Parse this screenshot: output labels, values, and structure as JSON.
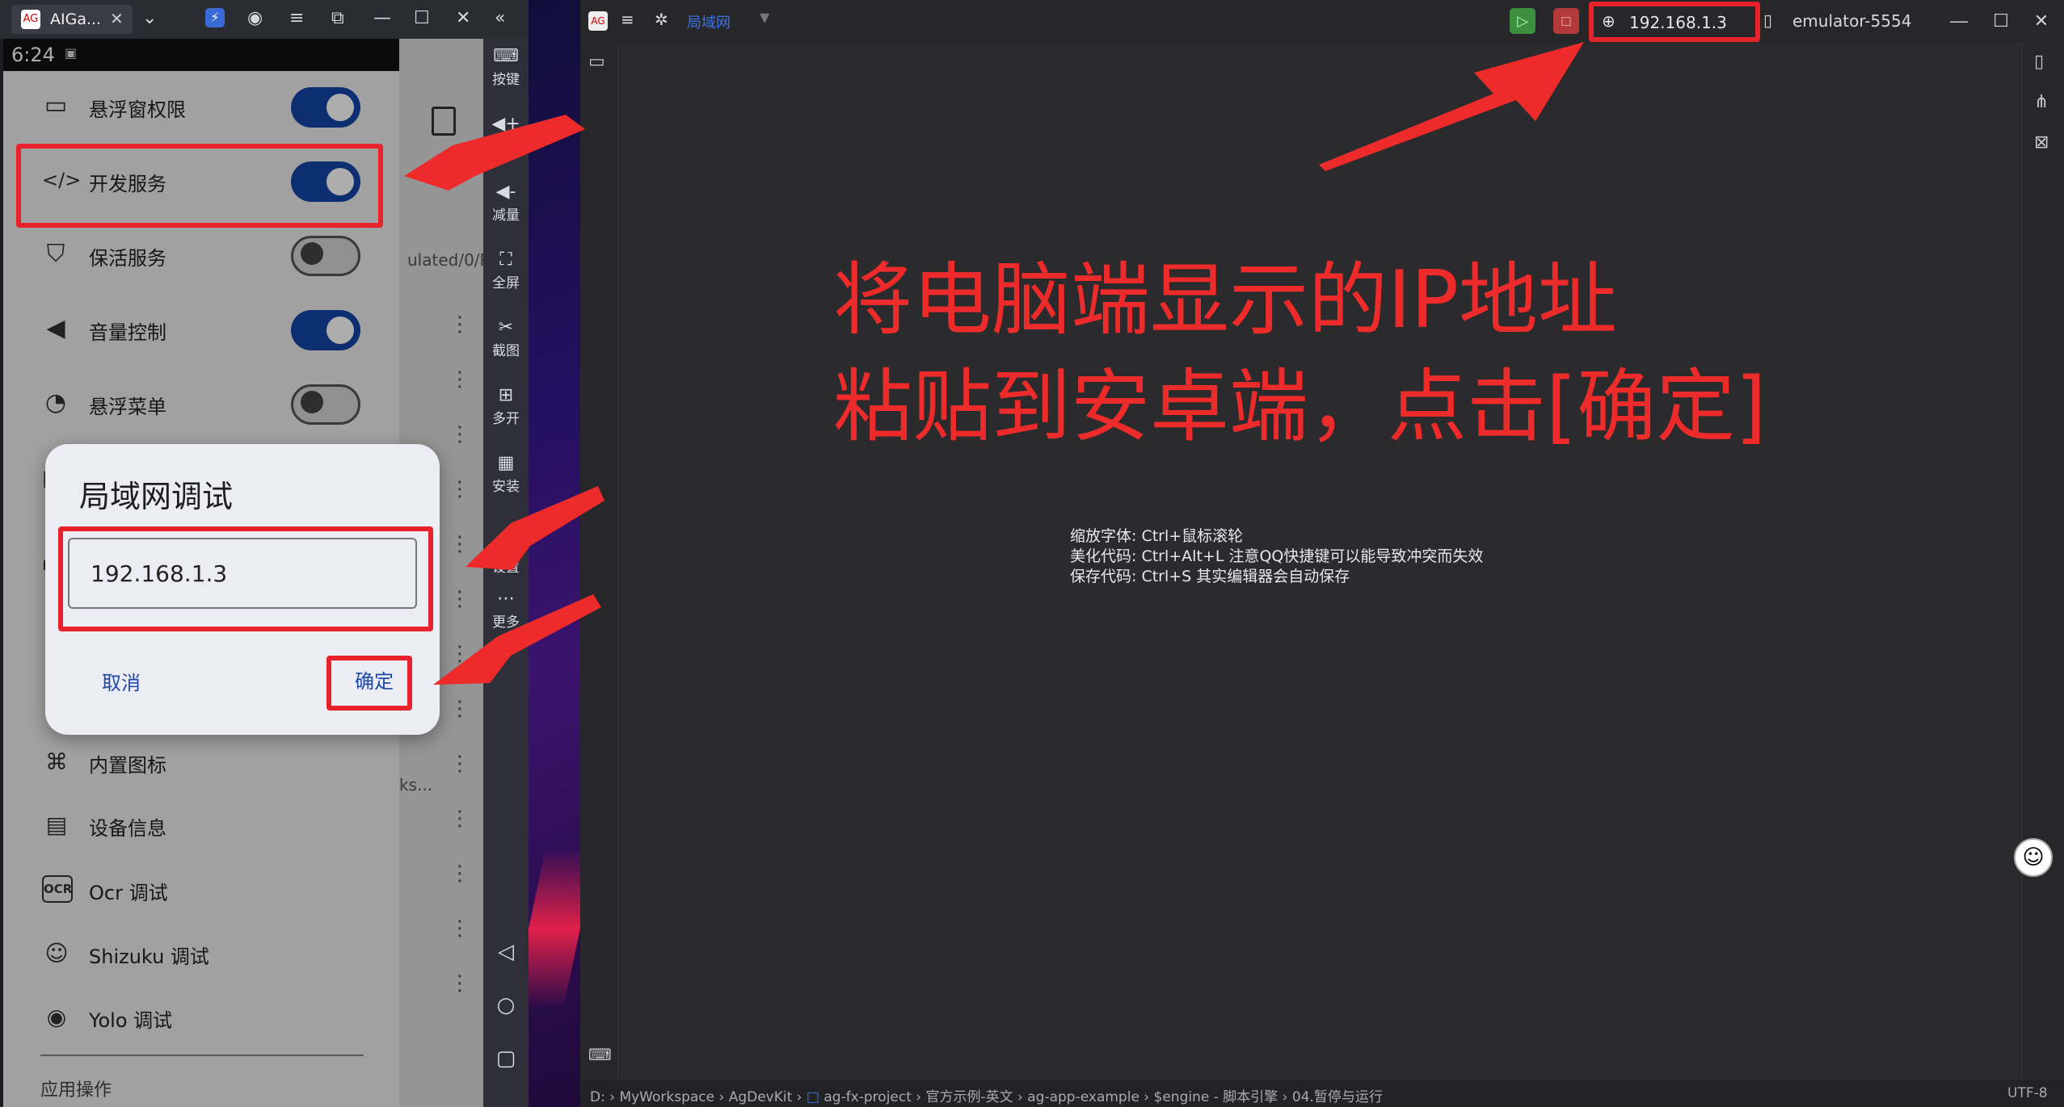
{
  "emulator": {
    "tab_title": "AIGa...",
    "phone_time": "6:24",
    "settings_rows": [
      {
        "label": "悬浮窗权限",
        "on": true,
        "icon": "window-icon"
      },
      {
        "label": "开发服务",
        "on": true,
        "icon": "code-icon"
      },
      {
        "label": "保活服务",
        "on": false,
        "icon": "shield-icon"
      },
      {
        "label": "音量控制",
        "on": true,
        "icon": "volume-icon"
      },
      {
        "label": "悬浮菜单",
        "on": false,
        "icon": "float-menu-icon"
      }
    ],
    "list_rows": [
      {
        "label": "内置图标",
        "icon": "grid-icon"
      },
      {
        "label": "设备信息",
        "icon": "device-info-icon"
      },
      {
        "label": "Ocr 调试",
        "icon": "ocr-icon"
      },
      {
        "label": "Shizuku 调试",
        "icon": "shizuku-icon"
      },
      {
        "label": "Yolo 调试",
        "icon": "eye-icon"
      }
    ],
    "section_footer": "应用操作",
    "side_toolbar": [
      "按键",
      "加量",
      "减量",
      "全屏",
      "截图",
      "多开",
      "安装",
      "设置",
      "更多"
    ],
    "behind_text": "ulated/0/Pic",
    "behind_text2": "ks..."
  },
  "dialog": {
    "title": "局域网调试",
    "ip_value": "192.168.1.3",
    "cancel_label": "取消",
    "ok_label": "确定"
  },
  "ide": {
    "mode_label": "局域网",
    "ip_address": "192.168.1.3",
    "device_name": "emulator-5554",
    "instruction_line1": "将电脑端显示的IP地址",
    "instruction_line2": "粘贴到安卓端，点击[确定]",
    "hints": [
      "缩放字体:  Ctrl+鼠标滚轮",
      "美化代码:  Ctrl+Alt+L 注意QQ快捷键可以能导致冲突而失效",
      "保存代码:  Ctrl+S 其实编辑器会自动保存"
    ],
    "breadcrumb": [
      "D:",
      "MyWorkspace",
      "AgDevKit",
      "ag-fx-project",
      "官方示例-英文",
      "ag-app-example",
      "$engine - 脚本引擎",
      "04.暂停与运行"
    ],
    "encoding": "UTF-8"
  },
  "colors": {
    "annotation_red": "#e8222a",
    "toggle_on": "#1645a8",
    "link_blue": "#1e4aa8"
  }
}
